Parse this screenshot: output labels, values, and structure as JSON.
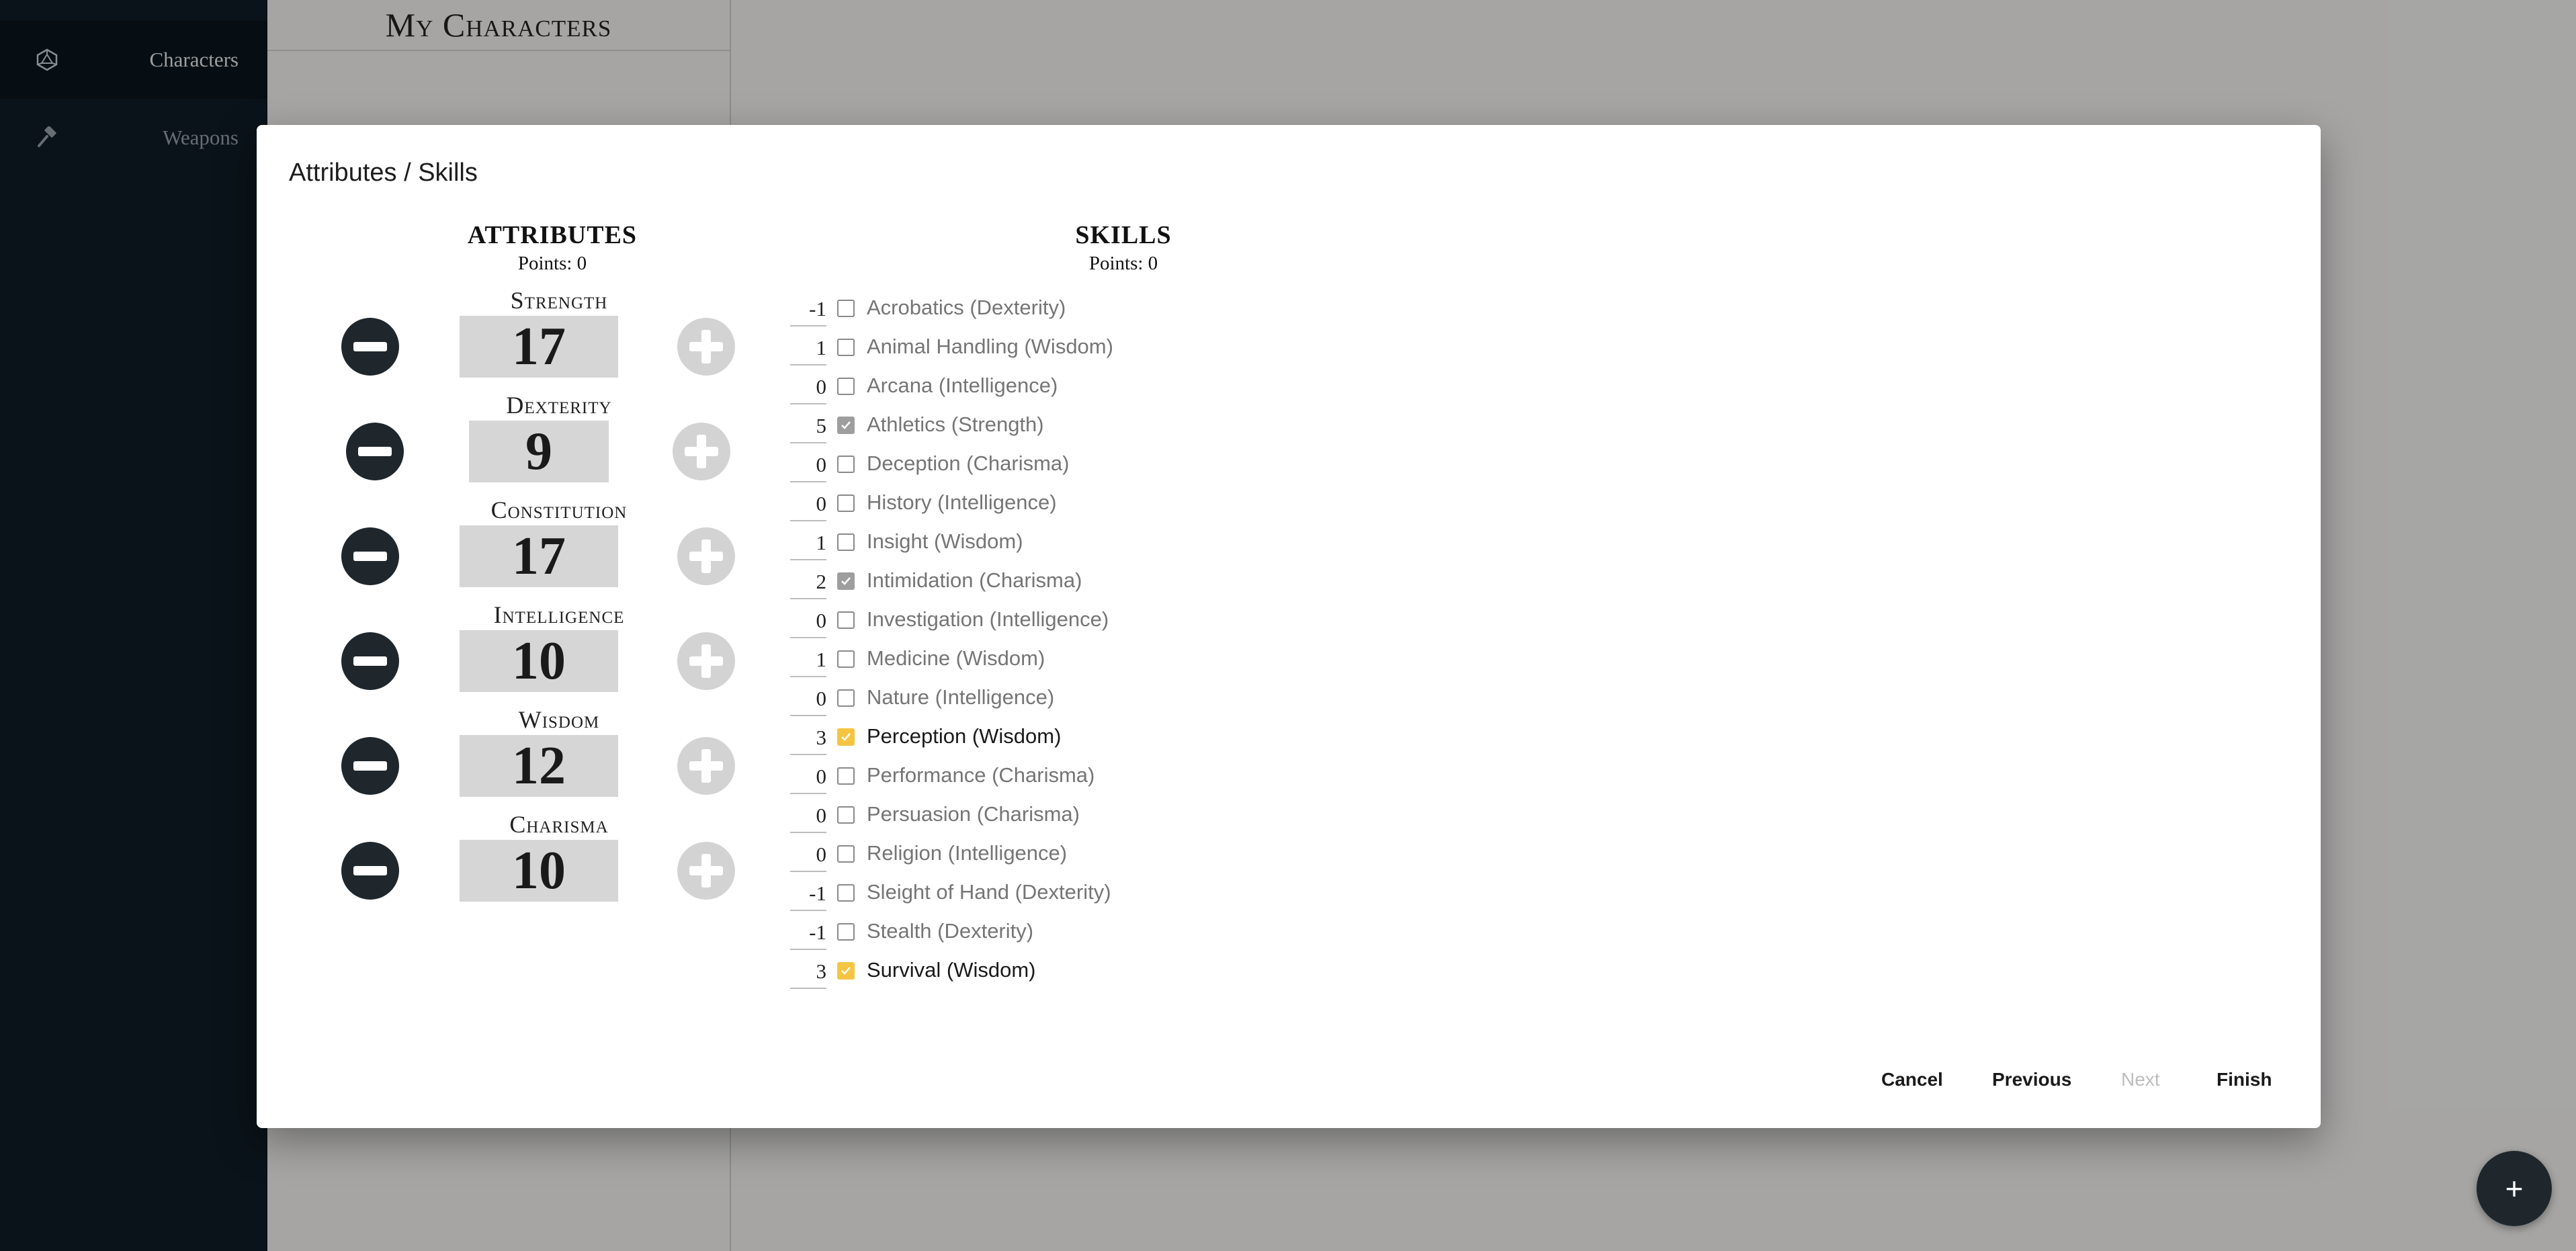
{
  "sidebar": {
    "items": [
      {
        "label": "Characters",
        "icon": "d20-icon",
        "active": true
      },
      {
        "label": "Weapons",
        "icon": "hammer-icon",
        "active": false
      }
    ]
  },
  "list_panel": {
    "title": "My Characters"
  },
  "modal": {
    "title": "Attributes / Skills",
    "attributes": {
      "heading": "ATTRIBUTES",
      "points": "Points: 0",
      "items": [
        {
          "name": "Strength",
          "value": "17"
        },
        {
          "name": "Dexterity",
          "value": "9"
        },
        {
          "name": "Constitution",
          "value": "17"
        },
        {
          "name": "Intelligence",
          "value": "10"
        },
        {
          "name": "Wisdom",
          "value": "12"
        },
        {
          "name": "Charisma",
          "value": "10"
        }
      ]
    },
    "skills": {
      "heading": "SKILLS",
      "points": "Points: 0",
      "items": [
        {
          "mod": "-1",
          "name": "Acrobatics (Dexterity)",
          "state": "unchecked"
        },
        {
          "mod": "1",
          "name": "Animal Handling (Wisdom)",
          "state": "unchecked"
        },
        {
          "mod": "0",
          "name": "Arcana (Intelligence)",
          "state": "unchecked"
        },
        {
          "mod": "5",
          "name": "Athletics (Strength)",
          "state": "proficient"
        },
        {
          "mod": "0",
          "name": "Deception (Charisma)",
          "state": "unchecked"
        },
        {
          "mod": "0",
          "name": "History (Intelligence)",
          "state": "unchecked"
        },
        {
          "mod": "1",
          "name": "Insight (Wisdom)",
          "state": "unchecked"
        },
        {
          "mod": "2",
          "name": "Intimidation (Charisma)",
          "state": "proficient"
        },
        {
          "mod": "0",
          "name": "Investigation (Intelligence)",
          "state": "unchecked"
        },
        {
          "mod": "1",
          "name": "Medicine (Wisdom)",
          "state": "unchecked"
        },
        {
          "mod": "0",
          "name": "Nature (Intelligence)",
          "state": "unchecked"
        },
        {
          "mod": "3",
          "name": "Perception (Wisdom)",
          "state": "chosen"
        },
        {
          "mod": "0",
          "name": "Performance (Charisma)",
          "state": "unchecked"
        },
        {
          "mod": "0",
          "name": "Persuasion (Charisma)",
          "state": "unchecked"
        },
        {
          "mod": "0",
          "name": "Religion (Intelligence)",
          "state": "unchecked"
        },
        {
          "mod": "-1",
          "name": "Sleight of Hand (Dexterity)",
          "state": "unchecked"
        },
        {
          "mod": "-1",
          "name": "Stealth (Dexterity)",
          "state": "unchecked"
        },
        {
          "mod": "3",
          "name": "Survival (Wisdom)",
          "state": "chosen"
        }
      ]
    },
    "footer": {
      "cancel": "Cancel",
      "previous": "Previous",
      "next": "Next",
      "finish": "Finish"
    }
  },
  "fab": {
    "label": "+"
  },
  "colors": {
    "sidebar_bg": "#0f1c25",
    "accent_checked": "#f5c542",
    "proficient_checked": "#9e9e9e",
    "attribute_box": "#d6d6d6"
  }
}
